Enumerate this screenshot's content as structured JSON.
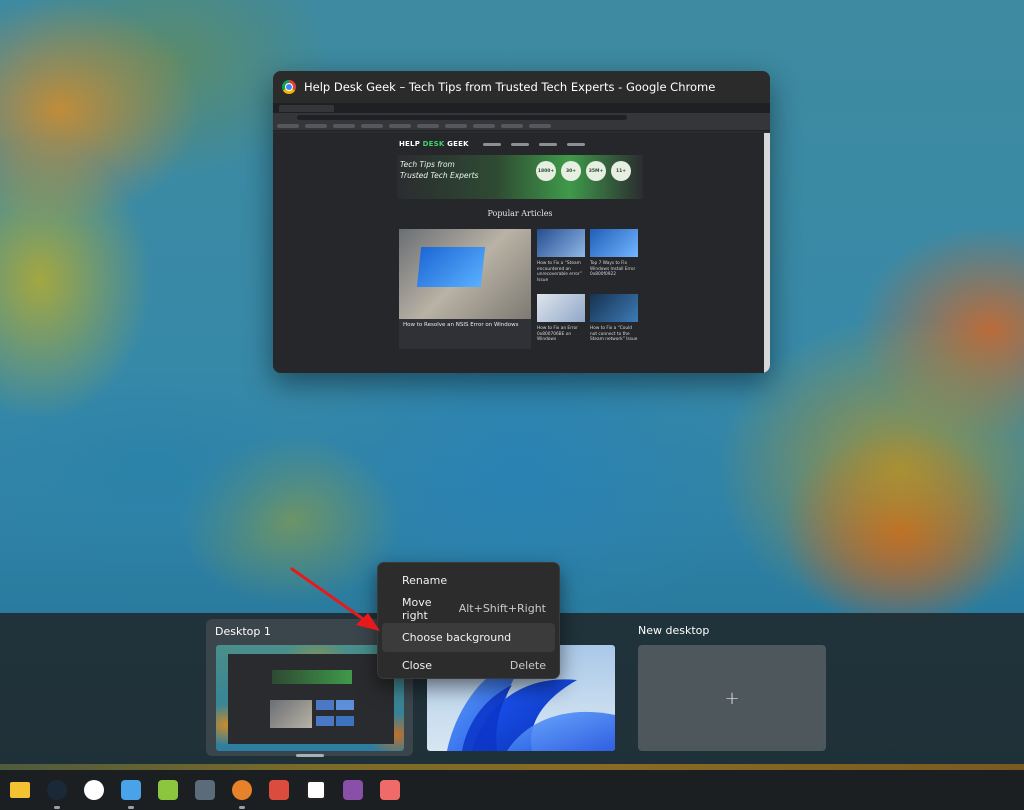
{
  "window_preview": {
    "title": "Help Desk Geek – Tech Tips from Trusted Tech Experts - Google Chrome",
    "site": {
      "logo_a": "HELP",
      "logo_b": "DESK",
      "logo_c": "GEEK",
      "hero_line1": "Tech Tips from",
      "hero_line2": "Trusted Tech Experts",
      "stats": [
        "1800+",
        "30+",
        "35M+",
        "11+"
      ],
      "section_heading": "Popular Articles",
      "featured_article": "How to Resolve an NSIS Error on Windows",
      "small_articles": [
        "How to Fix a “Steam encountered an unrecoverable error” Issue",
        "Top 7 Ways to Fix Windows Install Error 0x800f0922",
        "How to Fix an Error 0x800706BE on Windows",
        "How to Fix a “Could not connect to the Steam network” Issue"
      ]
    }
  },
  "task_view": {
    "desktops": [
      {
        "label": "Desktop 1"
      },
      {
        "label": ""
      }
    ],
    "new_desktop": {
      "label": "New desktop",
      "plus": "+"
    }
  },
  "context_menu": {
    "items": [
      {
        "label": "Rename",
        "shortcut": ""
      },
      {
        "label": "Move right",
        "shortcut": "Alt+Shift+Right"
      },
      {
        "label": "Choose background",
        "shortcut": ""
      },
      {
        "label": "Close",
        "shortcut": "Delete"
      }
    ],
    "highlighted_index": 2
  },
  "taskbar": {
    "apps": [
      {
        "name": "file-explorer-icon",
        "color": "#f2c233",
        "running": false
      },
      {
        "name": "steam-icon",
        "color": "#1b2838",
        "running": true
      },
      {
        "name": "slack-icon",
        "color": "#ffffff",
        "running": false
      },
      {
        "name": "notepad-icon",
        "color": "#4aa3e8",
        "running": true
      },
      {
        "name": "notepadpp-icon",
        "color": "#8cc63f",
        "running": false
      },
      {
        "name": "calculator-icon",
        "color": "#5b6b7a",
        "running": false
      },
      {
        "name": "firefox-dev-icon",
        "color": "#e8822a",
        "running": true
      },
      {
        "name": "todoist-icon",
        "color": "#db4c3f",
        "running": false
      },
      {
        "name": "notion-icon",
        "color": "#ffffff",
        "running": false
      },
      {
        "name": "winrar-icon",
        "color": "#8a4fa8",
        "running": false
      },
      {
        "name": "asana-icon",
        "color": "#f06a6a",
        "running": false
      }
    ]
  },
  "colors": {
    "menu_bg": "#2c2c2c",
    "menu_highlight": "#3b3b3b",
    "arrow": "#e8191b",
    "site_green": "#3fd36b"
  }
}
